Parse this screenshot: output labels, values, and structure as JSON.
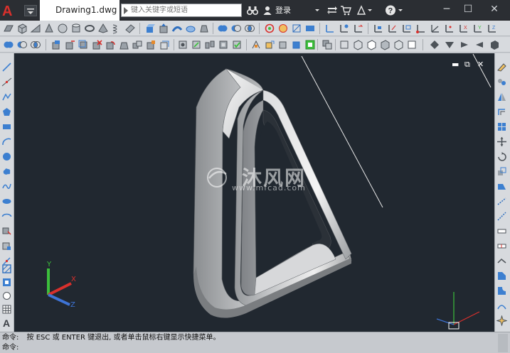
{
  "titlebar": {
    "logo_letter": "A",
    "document_tab": "Drawing1.dwg",
    "search_placeholder": "键入关键字或短语",
    "login_label": "登录",
    "minimize_glyph": "─",
    "maximize_glyph": "☐",
    "close_glyph": "✕",
    "help_glyph": "?"
  },
  "viewport": {
    "minimize_glyph": "▬",
    "restore_glyph": "⧉",
    "close_glyph": "✕",
    "watermark_text": "沐风网",
    "watermark_url": "www.mfcad.com",
    "background_color": "#212830",
    "ucs_axes": [
      "X",
      "Y",
      "Z"
    ]
  },
  "command": {
    "history_prompt": "命令:",
    "history_text": "按 ESC 或 ENTER 键退出, 或者单击鼠标右键显示快捷菜单。",
    "input_prompt": "命令:"
  },
  "colors": {
    "accent_red": "#d9302c",
    "axis_x": "#d9302c",
    "axis_y": "#3cbf3c",
    "axis_z": "#3e74d6",
    "ribbon_bg": "#d7dade",
    "titlebar_bg": "#2b2e33"
  },
  "icons": {
    "search": "search-arrow-icon",
    "binoculars": "binoculars-icon",
    "user": "user-icon",
    "cart": "cart-icon",
    "exchange": "exchange-icon",
    "help": "help-icon"
  }
}
